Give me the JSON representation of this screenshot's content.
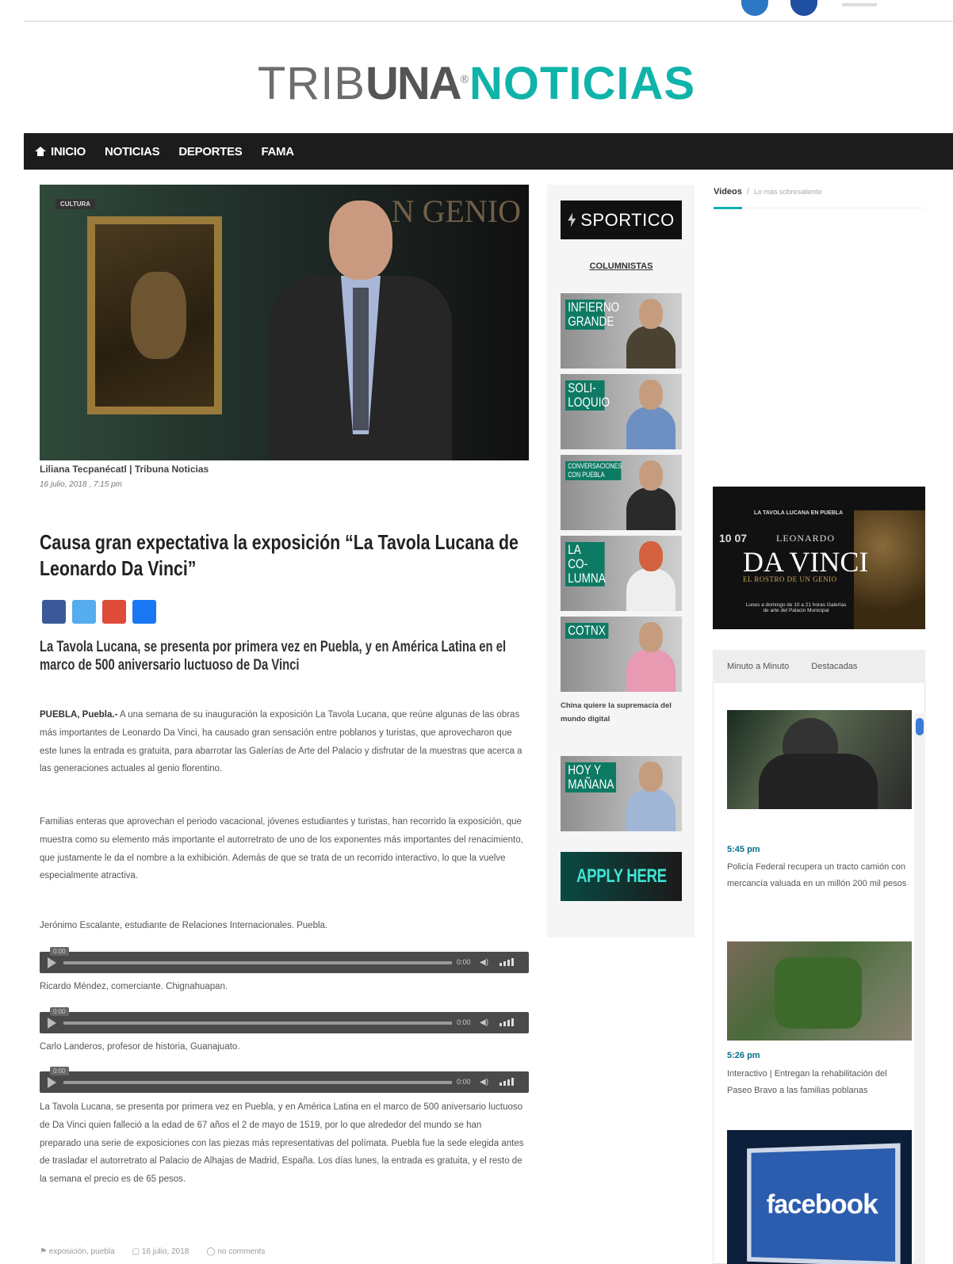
{
  "logo": {
    "part1": "TRIB",
    "part2": "UNA",
    "reg": "®",
    "part3": "NOTICIAS"
  },
  "nav": {
    "items": [
      "INICIO",
      "NOTICIAS",
      "DEPORTES",
      "FAMA"
    ]
  },
  "hero": {
    "badge": "CULTURA",
    "bg_text": "N GENIO"
  },
  "article": {
    "byline": "Liliana Tecpanécatl | Tribuna Noticias",
    "date": "16 julio, 2018 , 7:15 pm",
    "title": "Causa gran expectativa la exposición “La Tavola Lucana de Leonardo Da Vinci”",
    "subtitle": "La Tavola Lucana, se presenta por primera vez en Puebla, y en América Latina en el marco de 500 aniversario luctuoso de Da Vinci",
    "p1_lead": "PUEBLA, Puebla.-",
    "p1": " A una semana de su inauguración la exposición La Tavola Lucana, que reúne algunas de las obras más importantes  de Leonardo Da Vinci, ha causado gran sensación entre poblanos y turistas, que aprovecharon que este lunes la entrada es gratuita, para abarrotar las Galerías de Arte del Palacio y disfrutar de la muestras que acerca a las generaciones actuales al genio florentino.",
    "p2": "Familias enteras que aprovechan el periodo vacacional, jóvenes estudiantes y turistas, han recorrido la exposición, que muestra como su elemento más importante el autorretrato de uno de los exponentes más importantes del renacimiento, que justamente le da el nombre a la exhibición. Además de que se trata de un recorrido interactivo, lo que la vuelve especialmente atractiva.",
    "audio_caption_1": "Jerónimo Escalante, estudiante de Relaciones Internacionales. Puebla.",
    "audio_caption_2": "Ricardo Méndez, comerciante. Chignahuapan.",
    "audio_caption_3": "Carlo Landeros, profesor de historia, Guanajuato.",
    "p3": "La Tavola Lucana, se presenta por primera vez en Puebla, y en América Latina en el marco de 500 aniversario luctuoso de Da Vinci quien falleció a la edad de 67 años el 2 de mayo de 1519, por lo que alrededor del mundo se han preparado una serie de exposiciones con las piezas más representativas del polímata. Puebla fue la sede elegida antes de trasladar el autorretrato al Palacio de Alhajas de Madrid, España. Los días lunes, la entrada es gratuita, y el resto de la semana el precio es de 65 pesos.",
    "tag": "exposición, puebla",
    "tag_date": "16 julio, 2018",
    "comments": "no comments"
  },
  "audio": {
    "time0": "0:00",
    "dur": "0:00"
  },
  "sidebar_mid": {
    "sportico": "SPORTICO",
    "columnistas": "COLUMNISTAS",
    "columns": [
      "INFIERNO GRANDE",
      "SOLI- LOQUIO",
      "CONVERSACIONES CON PUEBLA",
      "LA CO- LUMNA",
      "COTNX"
    ],
    "note": "China quiere la supremacía del mundo digital",
    "column6": "HOY Y MAÑANA",
    "apply": "APPLY HERE"
  },
  "sidebar_right": {
    "videos_tab": "Videos",
    "videos_sub": "Lo más sobresaliente",
    "ad": {
      "top": "LA TAVOLA LUCANA EN PUEBLA",
      "l1": "LEONARDO",
      "l2": "DA VINCI",
      "l3": "EL ROSTRO DE UN GENIO",
      "dates": "10 07",
      "foot": "Lunes a domingo de 10 a 21 horas Galerías de arte del Palacio Municipal"
    },
    "tabs": [
      "Minuto a Minuto",
      "Destacadas"
    ],
    "news": [
      {
        "time": "5:45 pm",
        "text": "Policía Federal recupera un tracto camión con mercancía valuada en un millón 200 mil pesos"
      },
      {
        "time": "5:26 pm",
        "text": "Interactivo | Entregan la rehabilitación del Paseo Bravo a las familias poblanas"
      },
      {
        "time": "",
        "text": "facebook"
      }
    ]
  },
  "colors": {
    "accent": "#0fb3a9",
    "nav_bg": "#1c1c1c",
    "share": [
      "#3b5998",
      "#55acee",
      "#dd4b39",
      "#1877f2"
    ]
  }
}
